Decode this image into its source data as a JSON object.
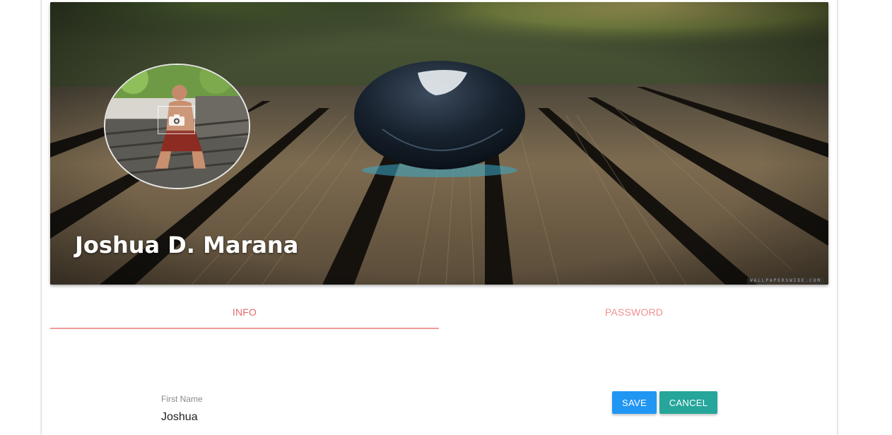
{
  "profile": {
    "name": "Joshua D. Marana",
    "cover_watermark": "WALLPAPERSWIDE.COM"
  },
  "tabs": [
    {
      "label": "INFO",
      "active": true
    },
    {
      "label": "PASSWORD",
      "active": false
    }
  ],
  "form": {
    "first_name_label": "First Name",
    "first_name_value": "Joshua"
  },
  "actions": {
    "save_label": "SAVE",
    "cancel_label": "CANCEL"
  },
  "icons": {
    "camera": "camera-icon"
  },
  "colors": {
    "tab_active": "#e06b6b",
    "tab_inactive": "#f08f8f",
    "tab_indicator": "#f09a9a",
    "save_button": "#2196f3",
    "cancel_button": "#26a69a"
  }
}
